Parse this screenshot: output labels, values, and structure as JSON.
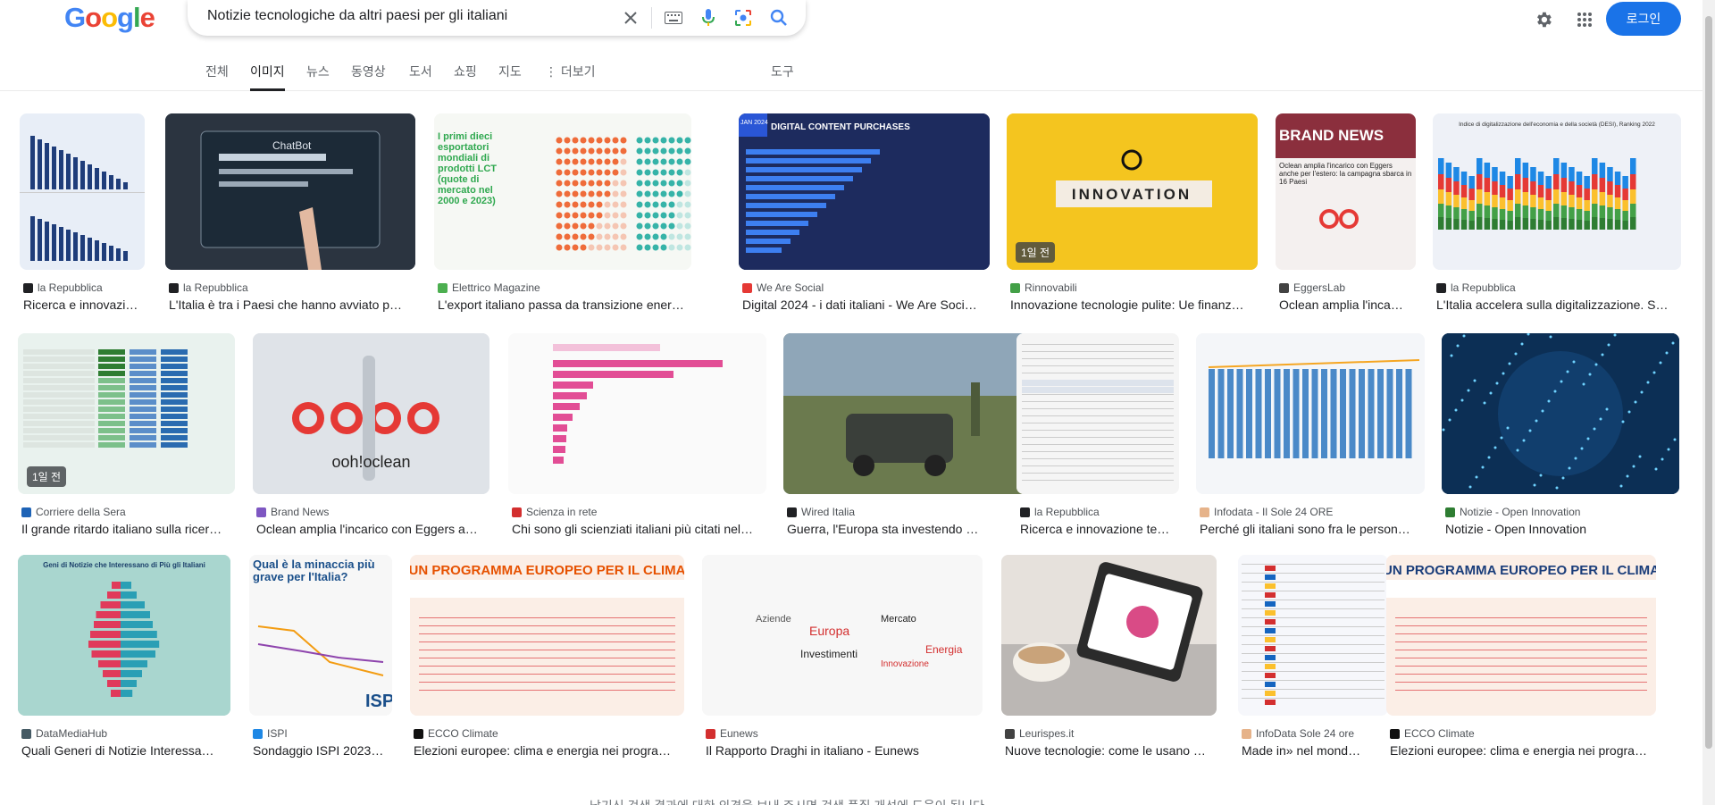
{
  "search": {
    "query": "Notizie tecnologiche da altri paesi per gli italiani"
  },
  "logo_letters": [
    {
      "ch": "G",
      "color": "#4285F4"
    },
    {
      "ch": "o",
      "color": "#EA4335"
    },
    {
      "ch": "o",
      "color": "#FBBC05"
    },
    {
      "ch": "g",
      "color": "#4285F4"
    },
    {
      "ch": "l",
      "color": "#34A853"
    },
    {
      "ch": "e",
      "color": "#EA4335"
    }
  ],
  "header": {
    "login_label": "로그인"
  },
  "tabs": [
    {
      "label": "전체"
    },
    {
      "label": "이미지"
    },
    {
      "label": "뉴스"
    },
    {
      "label": "동영상"
    },
    {
      "label": "도서"
    },
    {
      "label": "쇼핑"
    },
    {
      "label": "지도"
    },
    {
      "label": "⋮ 더보기"
    },
    {
      "label": "도구"
    }
  ],
  "results": [
    {
      "source": "la Repubblica",
      "title": "Ricerca e innovazi…",
      "badge": "",
      "fav": "#202124",
      "bg": "#e8eef7"
    },
    {
      "source": "la Repubblica",
      "title": "L'Italia è tra i Paesi che hanno avviato p…",
      "badge": "",
      "fav": "#202124",
      "bg": "#2b3440"
    },
    {
      "source": "Elettrico Magazine",
      "title": "L'export italiano passa da transizione energeti…",
      "badge": "",
      "fav": "#4caf50",
      "bg": "#f6f8f4"
    },
    {
      "source": "We Are Social",
      "title": "Digital 2024 - i dati italiani - We Are Soci…",
      "badge": "",
      "fav": "#e53935",
      "bg": "#1d2b5e"
    },
    {
      "source": "Rinnovabili",
      "title": "Innovazione tecnologie pulite: Ue finanz…",
      "badge": "1일 전",
      "fav": "#43a047",
      "bg": "#f4c51f"
    },
    {
      "source": "EggersLab",
      "title": "Oclean amplia l'inca…",
      "badge": "",
      "fav": "#424242",
      "bg": "#f4f0ef"
    },
    {
      "source": "la Repubblica",
      "title": "L'Italia accelera sulla digitalizzazione. S…",
      "badge": "",
      "fav": "#202124",
      "bg": "#eef1f7"
    },
    {
      "source": "Corriere della Sera",
      "title": "Il grande ritardo italiano sulla ricer…",
      "badge": "1일 전",
      "fav": "#1e63b6",
      "bg": "#e9f2ee"
    },
    {
      "source": "Brand News",
      "title": "Oclean amplia l'incarico con Eggers a…",
      "badge": "",
      "fav": "#7e57c2",
      "bg": "#dfe3e8"
    },
    {
      "source": "Scienza in rete",
      "title": "Chi sono gli scienziati italiani più citati nel…",
      "badge": "",
      "fav": "#d32f2f",
      "bg": "#fafafa"
    },
    {
      "source": "Wired Italia",
      "title": "Guerra, l'Europa sta investendo …",
      "badge": "",
      "fav": "#202124",
      "bg": "#5a6b4a"
    },
    {
      "source": "la Repubblica",
      "title": "Ricerca e innovazione te…",
      "badge": "",
      "fav": "#202124",
      "bg": "#f5f5f5"
    },
    {
      "source": "Infodata - Il Sole 24 ORE",
      "title": "Perché gli italiani sono fra le person…",
      "badge": "",
      "fav": "#e6b38a",
      "bg": "#f4f6f9"
    },
    {
      "source": "Notizie - Open Innovation",
      "title": "Notizie - Open Innovation",
      "badge": "",
      "fav": "#2e7d32",
      "bg": "#0c2f55"
    },
    {
      "source": "DataMediaHub",
      "title": "Quali Generi di Notizie Interessa…",
      "badge": "",
      "fav": "#455a64",
      "bg": "#a9d6cf"
    },
    {
      "source": "ISPI",
      "title": "Sondaggio ISPI 2023…",
      "badge": "",
      "fav": "#1e88e5",
      "bg": "#f7f7f7"
    },
    {
      "source": "ECCO Climate",
      "title": "Elezioni europee: clima e energia nei progra…",
      "badge": "",
      "fav": "#111111",
      "bg": "#fbeee6"
    },
    {
      "source": "Eunews",
      "title": "Il Rapporto Draghi in italiano - Eunews",
      "badge": "",
      "fav": "#d32f2f",
      "bg": "#f7f7f7"
    },
    {
      "source": "Leurispes.it",
      "title": "Nuove tecnologie: come le usano …",
      "badge": "",
      "fav": "#424242",
      "bg": "#e6e1dc"
    },
    {
      "source": "InfoData Sole 24 ore",
      "title": "Made in» nel mond…",
      "badge": "",
      "fav": "#e6b38a",
      "bg": "#f6f7fb"
    },
    {
      "source": "ECCO Climate",
      "title": "Elezioni europee: clima e energia nei programm…",
      "badge": "",
      "fav": "#111111",
      "bg": "#f3f0f7"
    }
  ],
  "thumb_text": {
    "t1": "ChatBot",
    "t2": "I primi dieci esportatori mondiali di prodotti LCT (quote di mercato nel 2000 e 2023)",
    "t3a": "JAN 2024",
    "t3b": "DIGITAL CONTENT PURCHASES",
    "t4": "INNOVATION",
    "t5": "BRAND NEWS",
    "t5b": "Oclean amplia l'incarico con Eggers anche per l'estero: la campagna sbarca in 16 Paesi",
    "t6": "Indice di digitalizzazione dell'economia e della società (DESI), Ranking 2022",
    "t8": "ooh!oclean",
    "t14": "Geni di Notizie che Interessano di Più gli Italiani",
    "t15": "Qual è la minaccia più grave per l'Italia?",
    "t16": "UN PROGRAMMA EUROPEO PER IL CLIMA",
    "t20": "UN PROGRAMMA EUROPEO PER IL CLIMA",
    "t15b": "ISPI"
  },
  "footer": {
    "note": "남기신 검색 결과에 대한 의견을 보내 주시면 검색 품질 개선에 도움이 됩니다."
  }
}
